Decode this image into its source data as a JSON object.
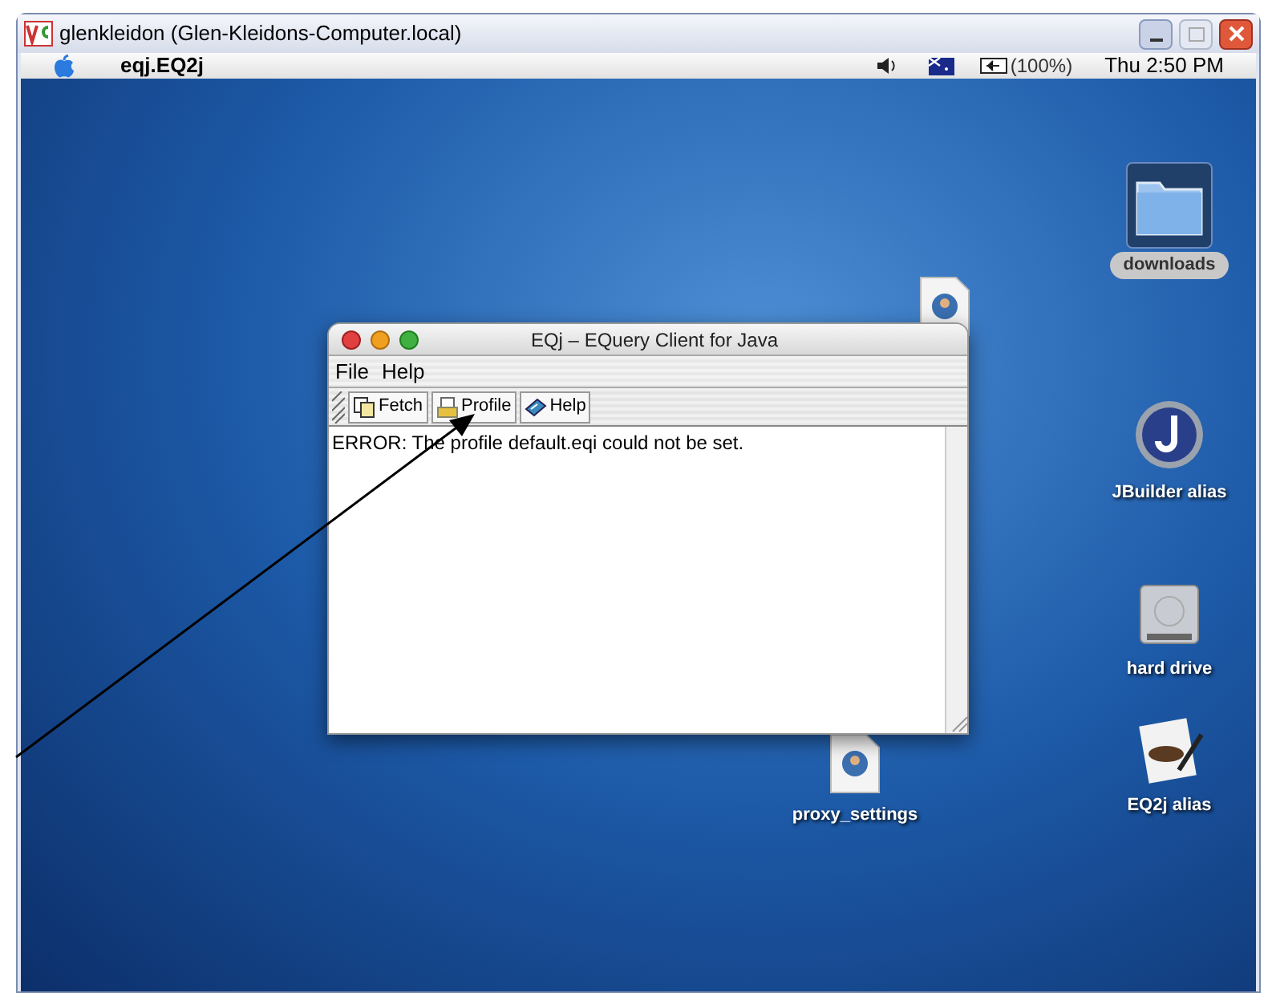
{
  "vnc_window": {
    "title": "glenkleidon (Glen-Kleidons-Computer.local)"
  },
  "menu_bar": {
    "app_name": "eqj.EQ2j",
    "battery": "(100%)",
    "clock": "Thu 2:50 PM"
  },
  "desktop_icons": [
    {
      "kind": "folder",
      "label": "downloads",
      "selected": true
    },
    {
      "kind": "image",
      "selected": false
    },
    {
      "kind": "app",
      "label": "JBuilder alias",
      "selected": false
    },
    {
      "kind": "disk",
      "label": "hard drive",
      "selected": false
    },
    {
      "kind": "image",
      "label": "proxy_settings",
      "selected": false
    },
    {
      "kind": "document",
      "label": "EQ2j alias",
      "selected": false
    }
  ],
  "app_window": {
    "title": "EQj – EQuery Client for Java",
    "menus": [
      "File",
      "Help"
    ],
    "toolbar": [
      {
        "kind": "fetch",
        "label": "Fetch"
      },
      {
        "kind": "profile",
        "label": "Profile"
      },
      {
        "kind": "help",
        "label": "Help"
      }
    ],
    "message": "ERROR: The profile default.eqi could not be set."
  }
}
